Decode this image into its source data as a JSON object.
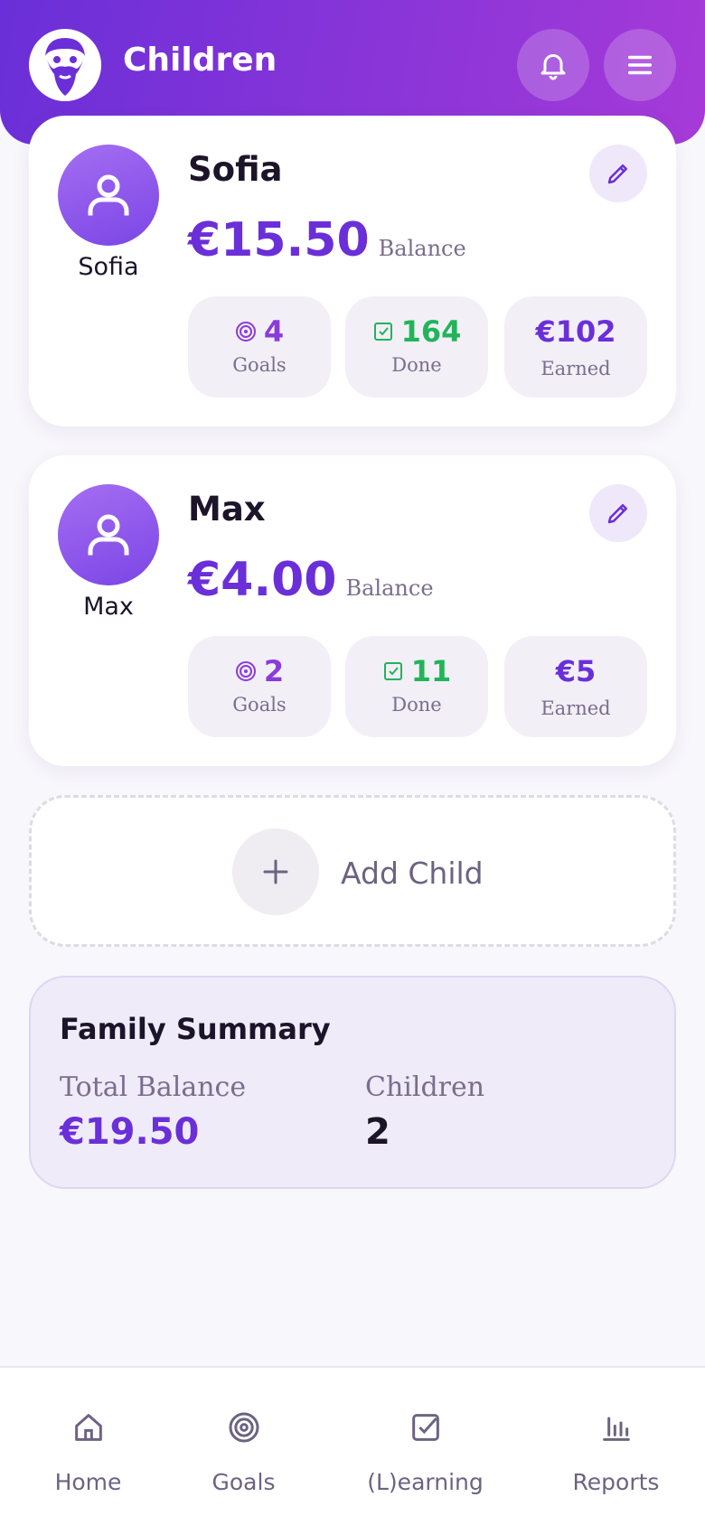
{
  "header": {
    "title": "Children",
    "logo_icon": "bearded-man-logo",
    "notification_icon": "bell-icon",
    "menu_icon": "menu-icon"
  },
  "children": [
    {
      "name": "Sofia",
      "avatar_label": "Sofia",
      "balance": "€15.50",
      "balance_label": "Balance",
      "stats": {
        "goals_value": "4",
        "goals_label": "Goals",
        "done_value": "164",
        "done_label": "Done",
        "earned_value": "€102",
        "earned_label": "Earned"
      }
    },
    {
      "name": "Max",
      "avatar_label": "Max",
      "balance": "€4.00",
      "balance_label": "Balance",
      "stats": {
        "goals_value": "2",
        "goals_label": "Goals",
        "done_value": "11",
        "done_label": "Done",
        "earned_value": "€5",
        "earned_label": "Earned"
      }
    }
  ],
  "add_child": {
    "label": "Add Child"
  },
  "summary": {
    "title": "Family Summary",
    "total_balance_label": "Total Balance",
    "total_balance_value": "€19.50",
    "children_label": "Children",
    "children_value": "2"
  },
  "nav": [
    {
      "label": "Home",
      "icon": "home-icon"
    },
    {
      "label": "Goals",
      "icon": "target-icon"
    },
    {
      "label": "(L)earning",
      "icon": "checkbox-icon"
    },
    {
      "label": "Reports",
      "icon": "bar-chart-icon"
    }
  ],
  "colors": {
    "brand_purple": "#6a2fd8",
    "goals_purple": "#8a3bdc",
    "done_green": "#22b45a"
  }
}
